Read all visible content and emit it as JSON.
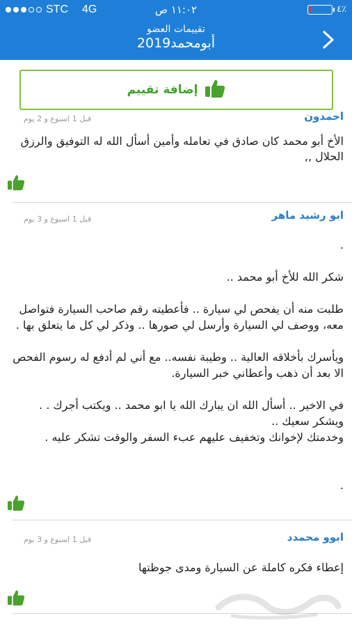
{
  "status_bar": {
    "carrier": "STC",
    "network": "4G",
    "time": "١١:٠٢ ص",
    "battery_percent": "٤٪",
    "battery_level": 0.04
  },
  "nav": {
    "subtitle": "تقييمات العضو",
    "title": "أبومحمد2019"
  },
  "add_rating": {
    "label": "إضافة تقييم"
  },
  "reviews": [
    {
      "name": "احمدون",
      "time": "قبل 1 اسبوع و 2 يوم",
      "body": "الأخ أبو محمد كان صادق في تعامله وأمين أسأل الله له التوفيق والرزق الحلال ,,"
    },
    {
      "name": "ابو رشيد ماهر",
      "time": "قبل 1 اسبوع و 3 يوم",
      "body": ".\n\nشكر الله للأخ أبو محمد ..\n\nطلبت منه أن يفحص لي سيارة .. فأعطيته رقم صاحب السيارة فتواصل معه، ووصف لي السيارة وأرسل لي صورها .. وذكر لي كل ما يتعلق بها .\n\nويأسرك بأخلاقه العالية .. وطيبة نفسه.. مع أني لم أدفع له رسوم الفحص الا بعد أن ذهب وأعطاني خبر السيارة.\n\nفي الاخير .. أسأل الله ان يبارك الله يا ابو محمد .. ويكتب أجرك . . ويشكر سعيك ..\nوخدمتك لإخوانك وتخفيف عليهم عبء السفر والوقت تشكر عليه .\n\n\n."
    },
    {
      "name": "ابوو محمدد",
      "time": "قبل 1 اسبوع و 3 يوم",
      "body": "إعطاء فكره كاملة عن السيارة ومدى جوظتها"
    }
  ]
}
